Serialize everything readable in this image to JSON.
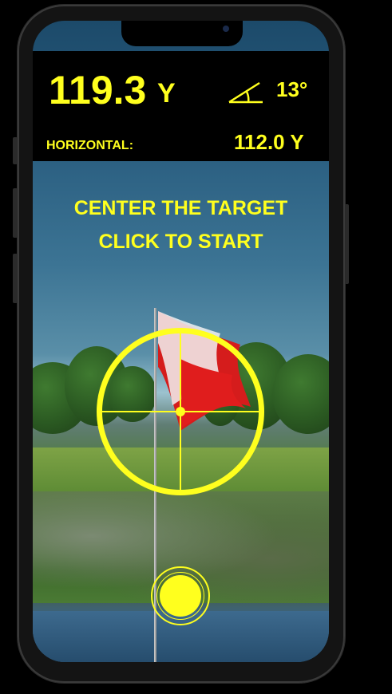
{
  "header": {
    "distance_value": "119.3",
    "distance_unit": "Y",
    "angle_value": "13°",
    "horizontal_label": "HORIZONTAL:",
    "horizontal_value": "112.0 Y"
  },
  "instruction": {
    "line1": "CENTER THE TARGET",
    "line2": "CLICK TO START"
  },
  "icons": {
    "angle": "angle-icon",
    "reticle": "crosshair-icon",
    "shutter": "shutter-button-icon"
  },
  "colors": {
    "accent": "#ffff1e",
    "header_bg": "#000000"
  }
}
